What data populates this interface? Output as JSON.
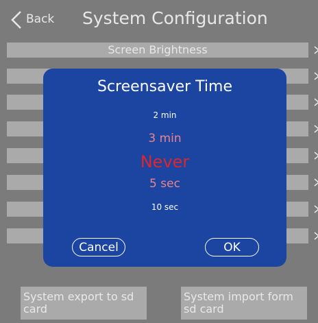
{
  "header": {
    "back_label": "Back",
    "title": "System Configuration"
  },
  "settings": {
    "rows": [
      {
        "label": "Screen Brightness"
      },
      {
        "label": ""
      },
      {
        "label": ""
      },
      {
        "label": ""
      },
      {
        "label": ""
      },
      {
        "label": ""
      },
      {
        "label": ""
      },
      {
        "label": ""
      }
    ]
  },
  "bottom": {
    "export_label": "System export to sd card",
    "import_label": "System import form sd card"
  },
  "dialog": {
    "title": "Screensaver Time",
    "options": [
      "2 min",
      "3 min",
      "Never",
      "5 sec",
      "10 sec"
    ],
    "selected": "Never",
    "cancel_label": "Cancel",
    "ok_label": "OK"
  },
  "colors": {
    "background": "#7b7b7b",
    "row_fill": "#a9aaa9",
    "dialog_fill": "#1c45a2",
    "selected_option": "#e0252a",
    "adjacent_option": "#e9858d"
  },
  "icons": {
    "back": "chevron-left-icon",
    "row_arrow": "chevron-right-icon"
  }
}
